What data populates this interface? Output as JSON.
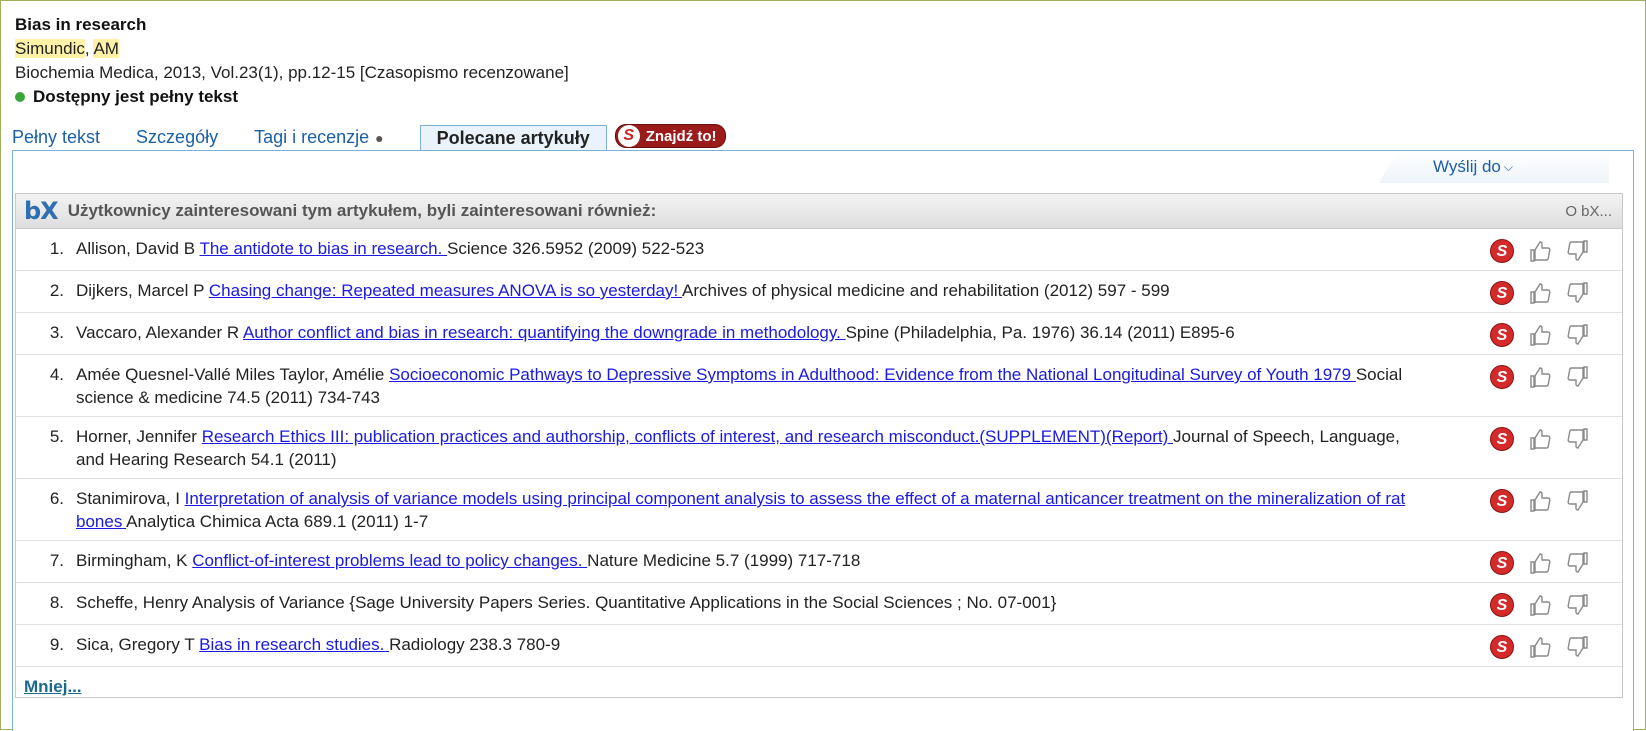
{
  "record": {
    "title": "Bias in research",
    "author_name": "Simundic",
    "author_sep": ", ",
    "author_initials": "AM",
    "source": "Biochemia Medica, 2013, Vol.23(1), pp.12-15 [Czasopismo recenzowane]",
    "availability": "Dostępny jest pełny tekst"
  },
  "tabs": [
    {
      "label": "Pełny tekst"
    },
    {
      "label": "Szczegóły"
    },
    {
      "label": "Tagi i recenzje",
      "bullet": "●"
    },
    {
      "label": "Polecane artykuły"
    }
  ],
  "findit": {
    "label": "Znajdź to!"
  },
  "send_to": {
    "label": "Wyślij do"
  },
  "bx": {
    "logo": "bX",
    "title": "Użytkownicy zainteresowani tym artykułem, byli zainteresowani również:",
    "about": "O bX..."
  },
  "articles": [
    {
      "num": "1.",
      "author": "Allison, David B ",
      "link": "The antidote to bias in research. ",
      "source": "Science 326.5952 (2009) 522-523"
    },
    {
      "num": "2.",
      "author": "Dijkers, Marcel P ",
      "link": "Chasing change: Repeated measures ANOVA is so yesterday! ",
      "source": "Archives of physical medicine and rehabilitation (2012) 597 - 599"
    },
    {
      "num": "3.",
      "author": "Vaccaro, Alexander R ",
      "link": "Author conflict and bias in research: quantifying the downgrade in methodology. ",
      "source": "Spine (Philadelphia, Pa. 1976) 36.14 (2011) E895-6"
    },
    {
      "num": "4.",
      "author": "Amée Quesnel-Vallé Miles Taylor, Amélie ",
      "link": "Socioeconomic Pathways to Depressive Symptoms in Adulthood: Evidence from the National Longitudinal Survey of Youth 1979 ",
      "source": "Social science & medicine 74.5 (2011) 734-743"
    },
    {
      "num": "5.",
      "author": "Horner, Jennifer ",
      "link": "Research Ethics III: publication practices and authorship, conflicts of interest, and research misconduct.(SUPPLEMENT)(Report) ",
      "source": "Journal of Speech, Language, and Hearing Research 54.1 (2011)"
    },
    {
      "num": "6.",
      "author": "Stanimirova, I ",
      "link": "Interpretation of analysis of variance models using principal component analysis to assess the effect of a maternal anticancer treatment on the mineralization of rat bones ",
      "source": "Analytica Chimica Acta 689.1 (2011) 1-7"
    },
    {
      "num": "7.",
      "author": "Birmingham, K ",
      "link": "Conflict-of-interest problems lead to policy changes. ",
      "source": "Nature Medicine 5.7 (1999) 717-718"
    },
    {
      "num": "8.",
      "author": "Scheffe, Henry ",
      "link": "",
      "source": "Analysis of Variance {Sage University Papers Series. Quantitative Applications in the Social Sciences ; No. 07-001}"
    },
    {
      "num": "9.",
      "author": "Sica, Gregory T ",
      "link": "Bias in research studies. ",
      "source": "Radiology 238.3 780-9"
    }
  ],
  "more": {
    "label": "Mniej..."
  },
  "icons": {
    "sfx": "sfx-findit-icon",
    "like": "thumbs-up-icon",
    "dislike": "thumbs-down-icon"
  },
  "colors": {
    "link": "#1a1ae0",
    "tab_link": "#1a5fa8",
    "available": "#3aa63a",
    "sfx_red": "#d42a2a",
    "highlight": "#fff2a8"
  }
}
